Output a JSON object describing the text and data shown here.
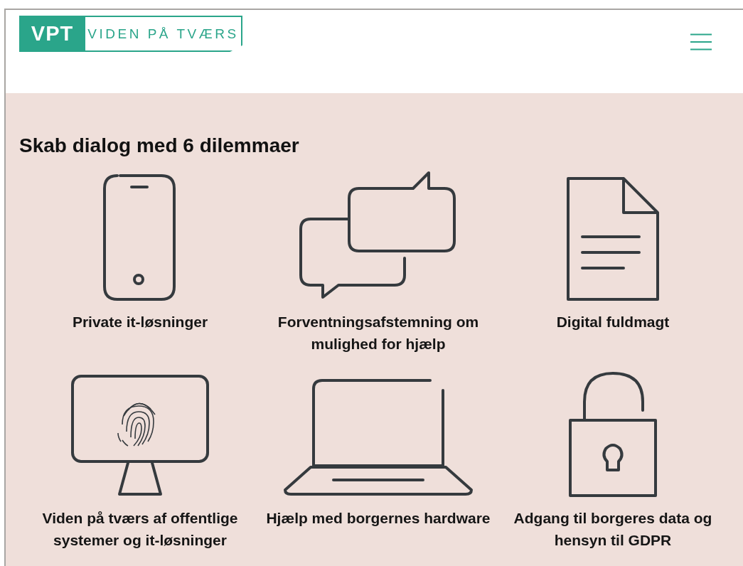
{
  "logo": {
    "mark": "VPT",
    "wordmark": "VIDEN PÅ TVÆRS"
  },
  "heading": "Skab dialog med 6 dilemmaer",
  "dilemmas": [
    {
      "kind": "phone",
      "label": "Private it-løsninger"
    },
    {
      "kind": "chat",
      "label": "Forventningsafstemning om mulighed for hjælp"
    },
    {
      "kind": "document",
      "label": "Digital fuldmagt"
    },
    {
      "kind": "monitor",
      "label": "Viden på tværs af offentlige systemer og it-løsninger"
    },
    {
      "kind": "laptop",
      "label": "Hjælp med borgernes hardware"
    },
    {
      "kind": "padlock",
      "label": "Adgang til borgeres data og hensyn til GDPR"
    }
  ]
}
